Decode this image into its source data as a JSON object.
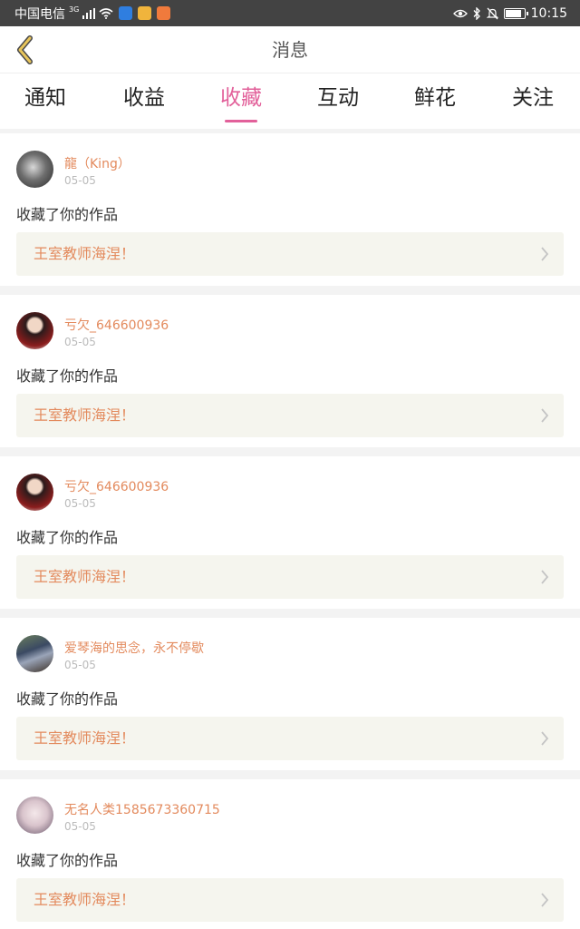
{
  "status_bar": {
    "carrier": "中国电信",
    "network": "3G",
    "time": "10:15",
    "battery_level": 0.9,
    "icons": [
      "signal-icon",
      "wifi-icon",
      "shield-app-icon",
      "grid-app-icon",
      "orange-app-icon",
      "eye-icon",
      "bluetooth-icon",
      "mute-bell-icon",
      "battery-icon"
    ]
  },
  "header": {
    "title": "消息",
    "back_icon": "chevron-left-icon"
  },
  "tabs": [
    {
      "label": "通知",
      "active": false
    },
    {
      "label": "收益",
      "active": false
    },
    {
      "label": "收藏",
      "active": true
    },
    {
      "label": "互动",
      "active": false
    },
    {
      "label": "鲜花",
      "active": false
    },
    {
      "label": "关注",
      "active": false
    }
  ],
  "colors": {
    "accent": "#e2609a",
    "name_text": "#e38a5d",
    "work_bg": "#f5f5ee",
    "status_bar_bg": "#434343"
  },
  "messages": [
    {
      "user": "龍（King）",
      "date": "05-05",
      "action": "收藏了你的作品",
      "work_title": "王室教师海涅！"
    },
    {
      "user": "亏欠_646600936",
      "date": "05-05",
      "action": "收藏了你的作品",
      "work_title": "王室教师海涅！"
    },
    {
      "user": "亏欠_646600936",
      "date": "05-05",
      "action": "收藏了你的作品",
      "work_title": "王室教师海涅！"
    },
    {
      "user": "爱琴海的思念，永不停歇",
      "date": "05-05",
      "action": "收藏了你的作品",
      "work_title": "王室教师海涅！"
    },
    {
      "user": "无名人类1585673360715",
      "date": "05-05",
      "action": "收藏了你的作品",
      "work_title": "王室教师海涅！"
    }
  ]
}
